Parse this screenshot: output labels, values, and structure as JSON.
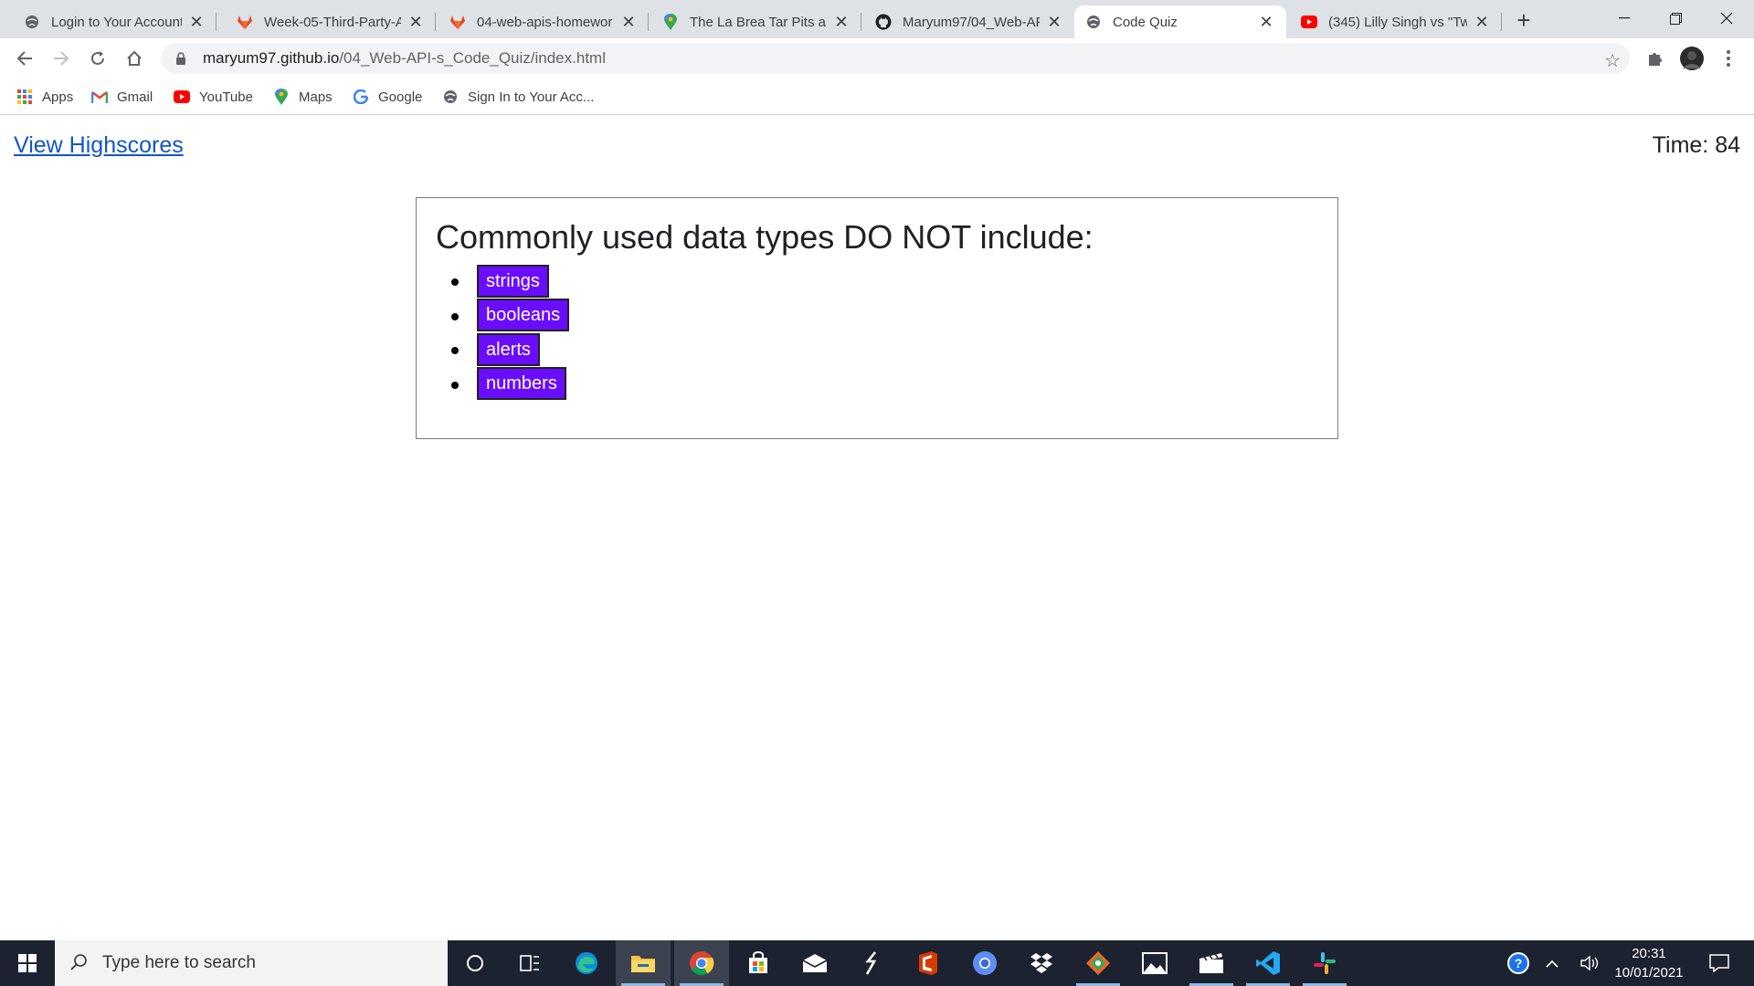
{
  "tabs": [
    {
      "label": "Login to Your Account",
      "icon": "globe-icon"
    },
    {
      "label": "Week-05-Third-Party-A",
      "icon": "gitlab-icon"
    },
    {
      "label": "04-web-apis-homewor",
      "icon": "gitlab-icon"
    },
    {
      "label": "The La Brea Tar Pits and",
      "icon": "maps-pin-icon"
    },
    {
      "label": "Maryum97/04_Web-AP",
      "icon": "github-icon"
    },
    {
      "label": "Code Quiz",
      "icon": "globe-icon",
      "active": true
    },
    {
      "label": "(345) Lilly Singh vs \"Tw",
      "icon": "youtube-icon"
    }
  ],
  "address": {
    "domain": "maryum97.github.io",
    "path": "/04_Web-API-s_Code_Quiz/index.html"
  },
  "bookmarks": [
    {
      "label": "Apps",
      "icon": "apps-grid-icon"
    },
    {
      "label": "Gmail",
      "icon": "gmail-icon"
    },
    {
      "label": "YouTube",
      "icon": "youtube-icon"
    },
    {
      "label": "Maps",
      "icon": "maps-pin-icon"
    },
    {
      "label": "Google",
      "icon": "google-icon"
    },
    {
      "label": "Sign In to Your Acc...",
      "icon": "globe-icon"
    }
  ],
  "page": {
    "highscores_link": "View Highscores",
    "timer": "Time: 84",
    "question": "Commonly used data types DO NOT include:",
    "answers": [
      "strings",
      "booleans",
      "alerts",
      "numbers"
    ],
    "answer_color": "#6a0dff"
  },
  "taskbar": {
    "search_placeholder": "Type here to search",
    "time": "20:31",
    "date": "10/01/2021"
  }
}
